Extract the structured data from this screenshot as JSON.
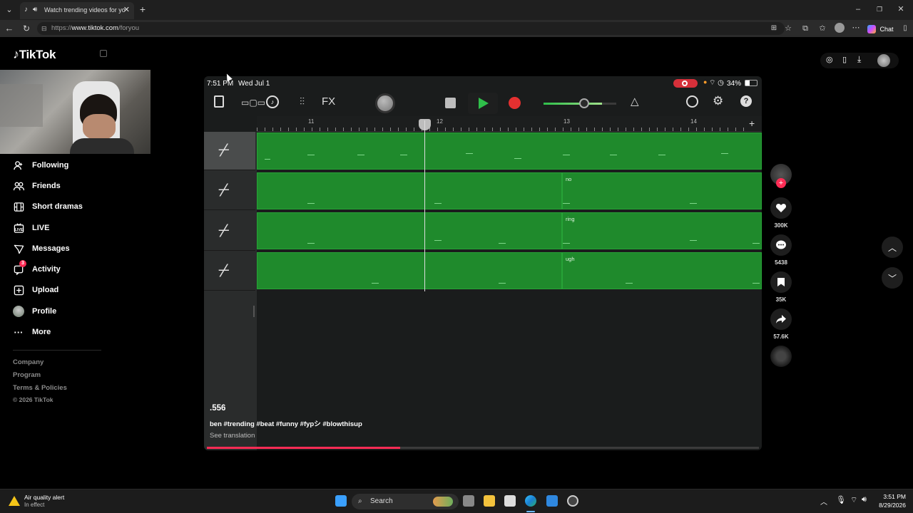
{
  "browser": {
    "tab_title": "Watch trending videos for yo",
    "url_prefix": "https://",
    "url_main": "www.tiktok.com",
    "url_path": "/foryou",
    "copilot_label": "Chat"
  },
  "tiktok": {
    "logo": "TikTok",
    "nav": [
      {
        "label": "Following",
        "icon": "following-icon"
      },
      {
        "label": "Friends",
        "icon": "friends-icon"
      },
      {
        "label": "Short dramas",
        "icon": "short-dramas-icon"
      },
      {
        "label": "LIVE",
        "icon": "live-icon"
      },
      {
        "label": "Messages",
        "icon": "messages-icon"
      },
      {
        "label": "Activity",
        "icon": "activity-icon",
        "badge": "3"
      },
      {
        "label": "Upload",
        "icon": "upload-icon"
      },
      {
        "label": "Profile",
        "icon": "profile-avatar"
      },
      {
        "label": "More",
        "icon": "more-icon"
      }
    ],
    "footer": [
      "Company",
      "Program",
      "Terms & Policies",
      "© 2026 TikTok"
    ]
  },
  "video": {
    "status_time": "7:51 PM",
    "status_date": "Wed Jul 1",
    "battery": "34%",
    "fx_label": "FX",
    "ruler": [
      "11",
      "12",
      "13",
      "14"
    ],
    "regions": [
      {
        "label": ""
      },
      {
        "label": "no"
      },
      {
        "label": "ring"
      },
      {
        "label": "ugh"
      }
    ],
    "author": ".556",
    "caption": "ben #trending #beat #funny #fypシ #blowthisup",
    "see_translation": "See translation",
    "progress": 0.35
  },
  "actions": {
    "likes": "300K",
    "comments": "5438",
    "saves": "35K",
    "shares": "57.6K"
  },
  "taskbar": {
    "alert_title": "Air quality alert",
    "alert_sub": "In effect",
    "search": "Search",
    "time": "3:51 PM",
    "date": "8/29/2026"
  },
  "colors": {
    "accent": "#fe2c55",
    "region_green": "#1f8a2c",
    "play_green": "#2fbf4a",
    "record_red": "#e53030"
  }
}
